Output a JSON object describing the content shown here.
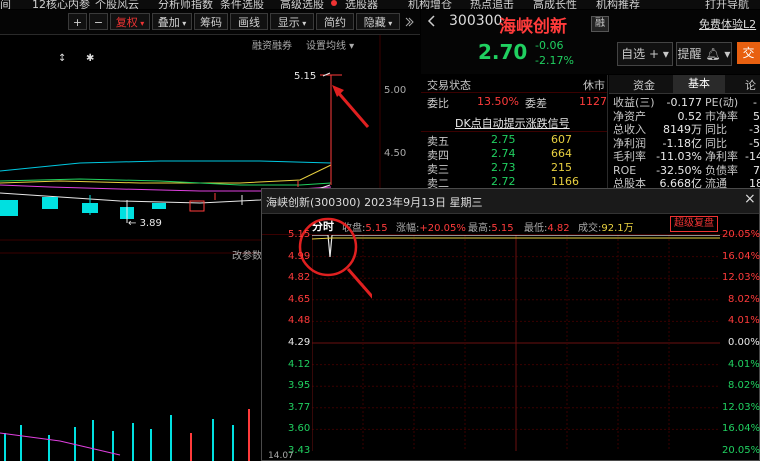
{
  "menu": [
    "间",
    "12核心内参",
    "个股风云",
    "分析师指数",
    "条件选股",
    "高级选股",
    "选股器",
    "机构增仓",
    "热点追击",
    "高成长性",
    "机构推荐",
    "打开导航"
  ],
  "toolbar": {
    "plus": "+",
    "minus": "−",
    "fuquan": "复权",
    "diejia": "叠加",
    "chouma": "筹码",
    "huaxian": "画线",
    "xianshi": "显示",
    "jianyue": "简约",
    "yincang": "隐藏",
    "rongzi": "融资融券",
    "shezhi": "设置均线"
  },
  "stock": {
    "code": "300300",
    "name": "海峡创新",
    "price": "2.70",
    "change": "-0.06",
    "change_pct": "-2.17%",
    "badge": "融",
    "trial": "免费体验L2",
    "zixuan": "自选",
    "tixing": "提醒",
    "extra": "交"
  },
  "kline": {
    "ylabels": [
      "5.00",
      "4.50"
    ],
    "high_label": "5.15",
    "low_label": "3.89",
    "markers": [
      "↕",
      "✱"
    ],
    "bottom_link": "改参数",
    "colors": {
      "up": "#ff3b3b",
      "down": "#00e0e0",
      "ma5": "#e8e8e8",
      "ma10": "#e8d040",
      "ma20": "#e040e0",
      "ma60": "#20d060",
      "arrow": "#e02020"
    }
  },
  "trade": {
    "status_label": "交易状态",
    "status_value": "休市",
    "weibi_label": "委比",
    "weibi_value": "13.50%",
    "weicha_label": "委差",
    "weicha_value": "1127",
    "dk_link": "DK点自动提示涨跌信号",
    "asks": [
      {
        "label": "卖五",
        "price": "2.75",
        "vol": "607"
      },
      {
        "label": "卖四",
        "price": "2.74",
        "vol": "664"
      },
      {
        "label": "卖三",
        "price": "2.73",
        "vol": "215"
      },
      {
        "label": "卖二",
        "price": "2.72",
        "vol": "1166"
      }
    ]
  },
  "fund": {
    "tabs": [
      "资金",
      "基本",
      "论"
    ],
    "rows": [
      {
        "l1": "收益(三)",
        "v1": "-0.177",
        "l2": "PE(动)",
        "v2": "-"
      },
      {
        "l1": "净资产",
        "v1": "0.52",
        "l2": "市净率",
        "v2": "5"
      },
      {
        "l1": "总收入",
        "v1": "8149万",
        "l2": "同比",
        "v2": "-3"
      },
      {
        "l1": "净利润",
        "v1": "-1.18亿",
        "l2": "同比",
        "v2": "-5"
      },
      {
        "l1": "毛利率",
        "v1": "-11.03%",
        "l2": "净利率",
        "v2": "-14"
      },
      {
        "l1": "ROE",
        "v1": "-32.50%",
        "l2": "负债率",
        "v2": "7"
      },
      {
        "l1": "总股本",
        "v1": "6.668亿",
        "l2": "流通",
        "v2": "18"
      }
    ]
  },
  "popup": {
    "title": "海峡创新(300300) 2023年9月13日 星期三",
    "close": "×",
    "fenshi": "分时",
    "shoupan_label": "收盘",
    "shoupan": "5.15",
    "zhangfu_label": "涨幅",
    "zhangfu": "+20.05%",
    "zuigao_label": "最高",
    "zuigao": "5.15",
    "zuidi_label": "最低",
    "zuidi": "4.82",
    "chengjiao_label": "成交",
    "chengjiao": "92.1万",
    "super_btn": "超级复盘",
    "left_axis": [
      "5.15",
      "4.99",
      "4.82",
      "4.65",
      "4.48",
      "4.29",
      "4.12",
      "3.95",
      "3.77",
      "3.60",
      "3.43"
    ],
    "right_axis": [
      "20.05%",
      "16.04%",
      "12.03%",
      "8.02%",
      "4.01%",
      "0.00%",
      "4.01%",
      "8.02%",
      "12.03%",
      "16.04%",
      "20.05%"
    ],
    "bottom_label": "14.07"
  }
}
